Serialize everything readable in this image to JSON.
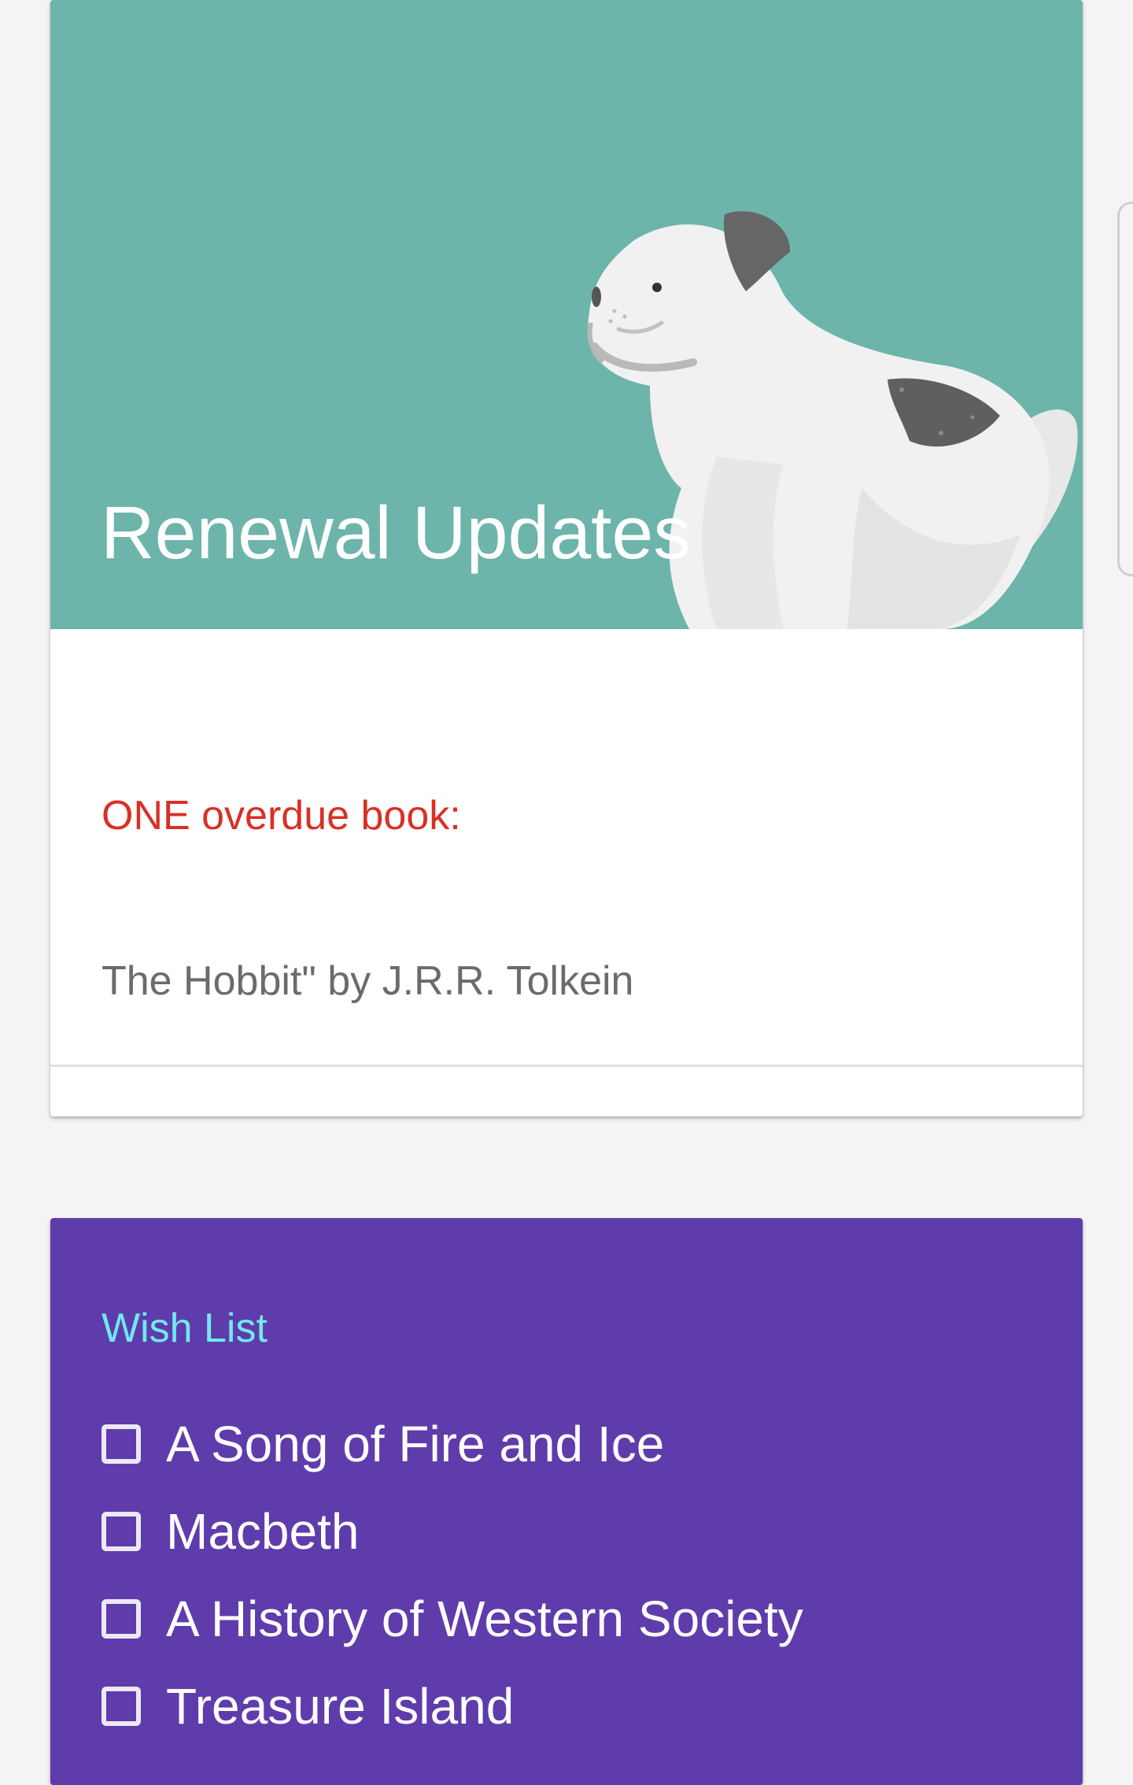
{
  "renewal": {
    "title": "Renewal Updates",
    "header_color": "#6db4aa",
    "overdue_heading": "ONE overdue book:",
    "overdue_color": "#d93025",
    "overdue_book": "The Hobbit\" by J.R.R. Tolkein",
    "illustration": "dog-illustration"
  },
  "wish_list": {
    "title": "Wish List",
    "background_color": "#5f3cab",
    "title_color": "#72e8ef",
    "items": [
      {
        "label": "A Song of Fire and Ice",
        "checked": false
      },
      {
        "label": "Macbeth",
        "checked": false
      },
      {
        "label": "A History of Western Society",
        "checked": false
      },
      {
        "label": "Treasure Island",
        "checked": false
      }
    ]
  },
  "edge_panel": {
    "icon": "edge-panel-handle"
  }
}
